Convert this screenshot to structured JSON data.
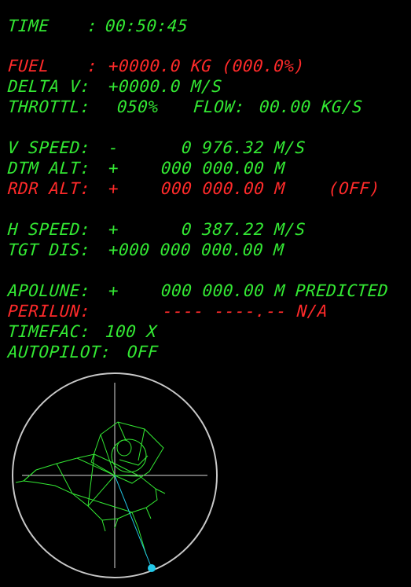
{
  "colors": {
    "background": "#000000",
    "normal": "#33e833",
    "warning": "#ff2a2a",
    "ring": "#c8c8c8",
    "crosshair": "#d8d8d8",
    "trajectory": "#22c8e8"
  },
  "time": {
    "label": "TIME",
    "sep": ":",
    "value": "00:50:45"
  },
  "fuel": {
    "label": "FUEL",
    "sep": ":",
    "value": "+0000.0 KG (000.0%)"
  },
  "delta_v": {
    "label": "DELTA V:",
    "value": "+0000.0 M/S"
  },
  "throttle": {
    "label": "THROTTL:",
    "value": "050%",
    "flow_label": "FLOW:",
    "flow_value": "00.00 KG/S"
  },
  "v_speed": {
    "label": "V SPEED:",
    "sign": "-",
    "value": "0 976.32 M/S"
  },
  "dtm_alt": {
    "label": "DTM ALT:",
    "sign": "+",
    "value": "000 000.00 M"
  },
  "rdr_alt": {
    "label": "RDR ALT:",
    "sign": "+",
    "value": "000 000.00 M",
    "status": "(OFF)"
  },
  "h_speed": {
    "label": "H SPEED:",
    "sign": "+",
    "value": "0 387.22 M/S"
  },
  "tgt_dis": {
    "label": "TGT DIS:",
    "value": "+000 000 000.00 M"
  },
  "apolune": {
    "label": "APOLUNE:",
    "sign": "+",
    "value": "000 000.00 M PREDICTED"
  },
  "perilun": {
    "label": "PERILUN:",
    "value": "---- ----.-- N/A"
  },
  "timefac": {
    "label": "TIMEFAC:",
    "value": "100 X"
  },
  "autopilot": {
    "label": "AUTOPILOT:",
    "value": "OFF"
  },
  "attitude_indicator": {
    "icon": "lunar-lander-wireframe-icon",
    "trajectory_marker": "trajectory-dot-icon"
  }
}
